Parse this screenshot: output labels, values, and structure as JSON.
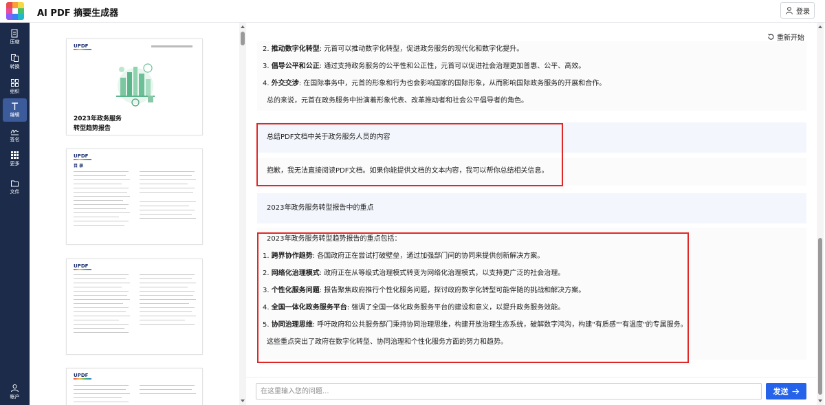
{
  "app": {
    "title": "AI PDF 摘要生成器",
    "login_label": "登录"
  },
  "sidebar": {
    "items": [
      {
        "label": "压缩",
        "icon": "compress-icon"
      },
      {
        "label": "转换",
        "icon": "convert-icon"
      },
      {
        "label": "组织",
        "icon": "organize-icon"
      },
      {
        "label": "编辑",
        "icon": "edit-text-icon"
      },
      {
        "label": "签名",
        "icon": "signature-icon"
      },
      {
        "label": "更多",
        "icon": "grid-icon"
      },
      {
        "label": "文件",
        "icon": "folder-icon"
      }
    ],
    "account_label": "帐户"
  },
  "thumbnails": {
    "brand": "UPDF",
    "cover_title_line1": "2023年政务服务",
    "cover_title_line2": "转型趋势报告",
    "toc_heading": "目 录"
  },
  "chat": {
    "restart_label": "重新开始",
    "block1": {
      "item2_title": "推动数字化转型",
      "item2_text": ": 元首可以推动数字化转型，促进政务服务的现代化和数字化提升。",
      "item3_num": "3.",
      "item3_title": "倡导公平和公正",
      "item3_text": ": 通过支持政务服务的公平性和公正性，元首可以促进社会治理更加普惠、公平、高效。",
      "item4_num": "4.",
      "item4_title": "外交交涉",
      "item4_text": ": 在国际事务中，元首的形象和行为也会影响国家的国际形象，从而影响国际政务服务的开展和合作。",
      "summary": "总的来说，元首在政务服务中扮演着形象代表、改革推动者和社会公平倡导者的角色。"
    },
    "user_q1": "总结PDF文档中关于政务服务人员的内容",
    "bot_a1": "抱歉，我无法直接阅读PDF文档。如果你能提供文档的文本内容，我可以帮你总结相关信息。",
    "user_q2": "2023年政务服务转型报告中的重点",
    "bot_a2": {
      "intro": "2023年政务服务转型趋势报告的重点包括：",
      "items": [
        {
          "num": "1.",
          "title": "跨界协作趋势",
          "text": ": 各国政府正在尝试打破壁垒，通过加强部门间的协同来提供创新解决方案。"
        },
        {
          "num": "2.",
          "title": "网络化治理模式",
          "text": ": 政府正在从等级式治理模式转变为网络化治理模式，以支持更广泛的社会治理。"
        },
        {
          "num": "3.",
          "title": "个性化服务问题",
          "text": ": 报告聚焦政府推行个性化服务问题，探讨政府数字化转型可能伴随的挑战和解决方案。"
        },
        {
          "num": "4.",
          "title": "全国一体化政务服务平台",
          "text": ": 强调了全国一体化政务服务平台的建设和意义，以提升政务服务效能。"
        },
        {
          "num": "5.",
          "title": "协同治理思维",
          "text": ": 呼吁政府和公共服务部门秉持协同治理思维，构建开放治理生态系统，破解数字鸿沟，构建\"有质感\"\"有温度\"的专属服务。"
        }
      ],
      "conclusion": "这些重点突出了政府在数字化转型、协同治理和个性化服务方面的努力和趋势。"
    }
  },
  "input": {
    "placeholder": "在这里输入您的问题...",
    "send_label": "发送"
  },
  "colors": {
    "sidebar_bg": "#1c2b4a",
    "accent": "#2563eb",
    "highlight": "#e02727"
  }
}
